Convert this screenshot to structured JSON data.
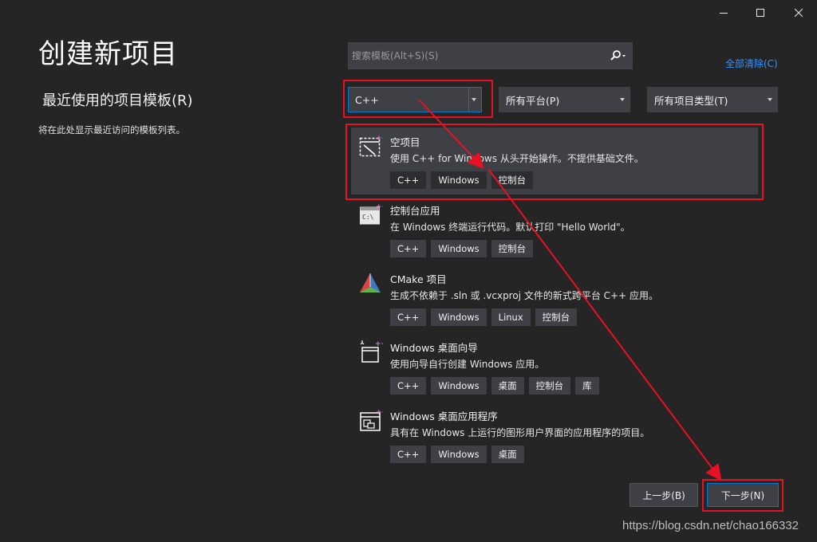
{
  "window": {
    "minimize_icon": "minimize-icon",
    "maximize_icon": "maximize-icon",
    "close_icon": "close-icon"
  },
  "page": {
    "title": "创建新项目",
    "recent_title": "最近使用的项目模板(R)",
    "recent_desc": "将在此处显示最近访问的模板列表。"
  },
  "search": {
    "placeholder": "搜索模板(Alt+S)(S)",
    "icon": "search-icon"
  },
  "clear_all": "全部清除(C)",
  "filters": {
    "language": "C++",
    "platform": "所有平台(P)",
    "project_type": "所有项目类型(T)"
  },
  "templates": [
    {
      "name": "空项目",
      "desc": "使用 C++ for Windows 从头开始操作。不提供基础文件。",
      "tags": [
        "C++",
        "Windows",
        "控制台"
      ],
      "icon": "empty-project-icon",
      "selected": true
    },
    {
      "name": "控制台应用",
      "desc": "在 Windows 终端运行代码。默认打印 \"Hello World\"。",
      "tags": [
        "C++",
        "Windows",
        "控制台"
      ],
      "icon": "console-app-icon",
      "selected": false
    },
    {
      "name": "CMake 项目",
      "desc": "生成不依赖于 .sln 或 .vcxproj 文件的新式跨平台 C++ 应用。",
      "tags": [
        "C++",
        "Windows",
        "Linux",
        "控制台"
      ],
      "icon": "cmake-icon",
      "selected": false
    },
    {
      "name": "Windows 桌面向导",
      "desc": "使用向导自行创建 Windows 应用。",
      "tags": [
        "C++",
        "Windows",
        "桌面",
        "控制台",
        "库"
      ],
      "icon": "desktop-wizard-icon",
      "selected": false
    },
    {
      "name": "Windows 桌面应用程序",
      "desc": "具有在 Windows 上运行的图形用户界面的应用程序的项目。",
      "tags": [
        "C++",
        "Windows",
        "桌面"
      ],
      "icon": "desktop-app-icon",
      "selected": false
    }
  ],
  "buttons": {
    "back": "上一步(B)",
    "next": "下一步(N)"
  },
  "watermark": "https://blog.csdn.net/chao166332",
  "colors": {
    "background": "#252526",
    "surface": "#3f3f46",
    "accent": "#007acc",
    "link": "#3794ff",
    "annotation_red": "#e81123"
  }
}
